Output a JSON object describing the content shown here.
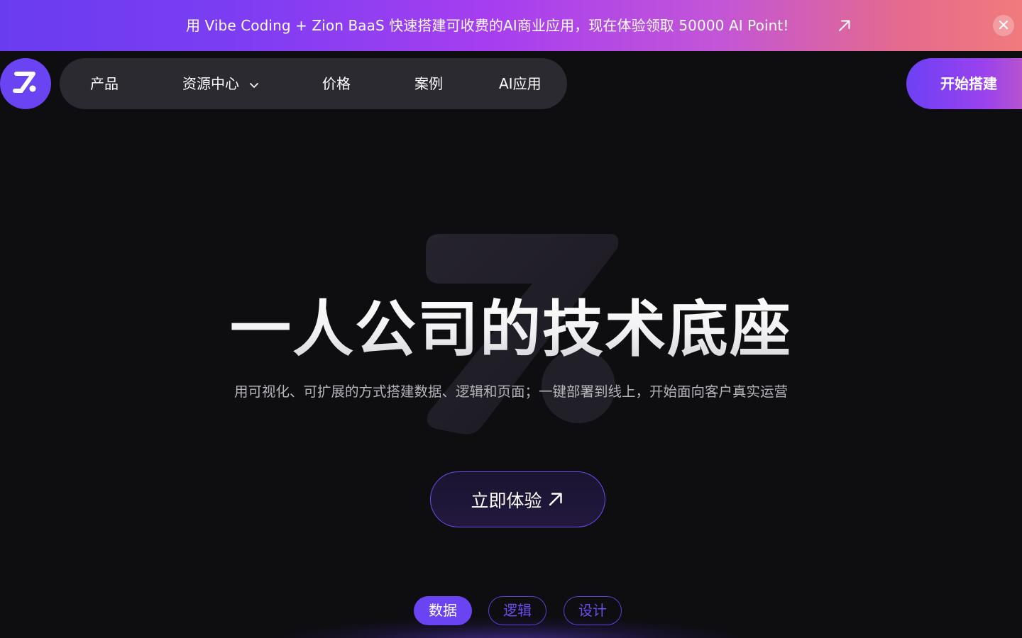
{
  "promo": {
    "text": "用 Vibe Coding + Zion BaaS 快速搭建可收费的AI商业应用，现在体验领取 50000 AI Point!",
    "link_icon": "arrow-up-right-icon",
    "close_icon": "close-icon"
  },
  "nav": {
    "logo_icon": "zion-logo-icon",
    "items": [
      {
        "label": "产品"
      },
      {
        "label": "资源中心",
        "icon": "chevron-down-icon"
      },
      {
        "label": "价格"
      },
      {
        "label": "案例"
      },
      {
        "label": "AI应用"
      }
    ],
    "start_label": "开始搭建"
  },
  "hero": {
    "title": "一人公司的技术底座",
    "subtitle": "用可视化、可扩展的方式搭建数据、逻辑和页面；一键部署到线上，开始面向客户真实运营",
    "cta_label": "立即体验",
    "cta_icon": "arrow-up-right-icon"
  },
  "tabs": [
    {
      "label": "数据",
      "active": true
    },
    {
      "label": "逻辑",
      "active": false
    },
    {
      "label": "设计",
      "active": false
    }
  ],
  "colors": {
    "accent": "#6a44f2",
    "background": "#0e0d10",
    "nav_pill": "#2a2a30"
  }
}
